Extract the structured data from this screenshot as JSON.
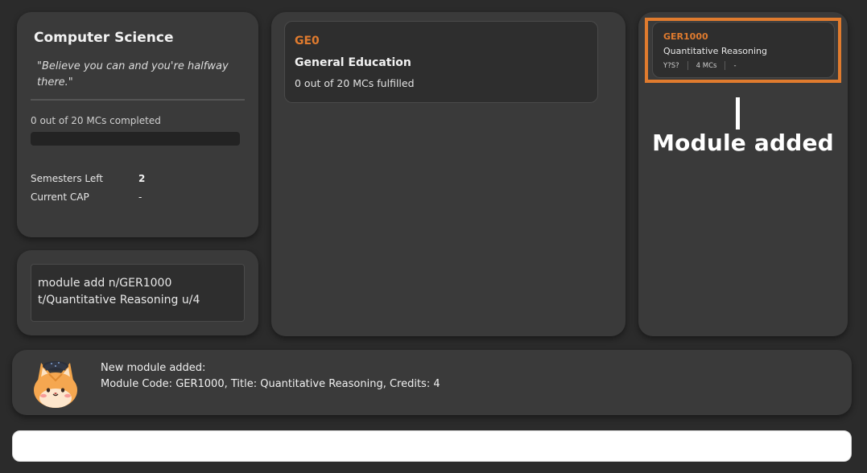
{
  "profile": {
    "course": "Computer Science",
    "quote": "\"Believe you can and you're halfway there.\"",
    "mc_progress_text": "0 out of 20 MCs completed",
    "mc_progress_fraction": 0,
    "semesters_label": "Semesters Left",
    "semesters_value": "2",
    "cap_label": "Current CAP",
    "cap_value": "-"
  },
  "command_box": {
    "text": "module add n/GER1000 t/Quantitative Reasoning u/4"
  },
  "requirement": {
    "code": "GE0",
    "title": "General Education",
    "progress": "0 out of 20 MCs fulfilled"
  },
  "module": {
    "code": "GER1000",
    "title": "Quantitative Reasoning",
    "semester": "Y?S?",
    "credits": "4 MCs",
    "grade": "-"
  },
  "annotation": {
    "text": "Module added"
  },
  "result": {
    "line1": "New module added:",
    "line2": "Module Code: GER1000, Title: Quantitative Reasoning, Credits: 4",
    "mascot_icon": "cat-graduate-icon"
  },
  "command_input": {
    "value": "",
    "placeholder": ""
  },
  "colors": {
    "accent": "#e07b2e",
    "background": "#2b2b2b",
    "panel": "#3a3a3a"
  }
}
